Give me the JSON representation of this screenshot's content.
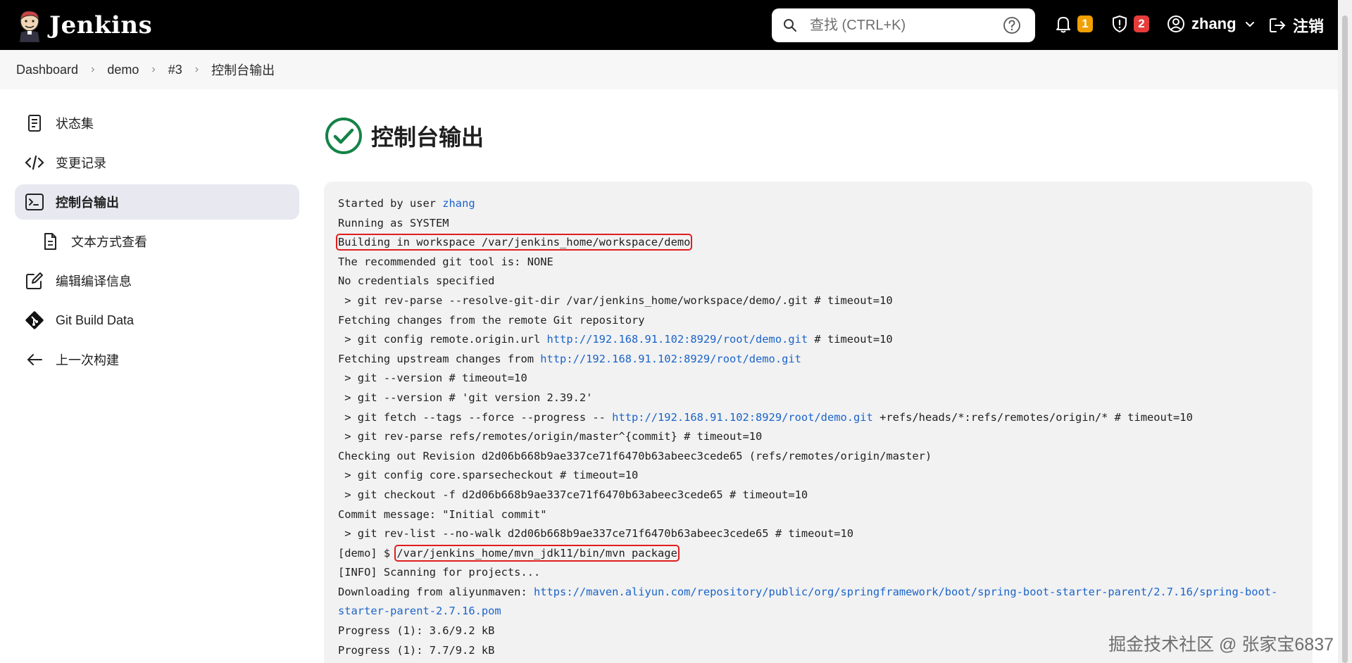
{
  "header": {
    "brand": "Jenkins",
    "search_placeholder": "查找 (CTRL+K)",
    "notifications_count": "1",
    "security_count": "2",
    "user": "zhang",
    "logout": "注销"
  },
  "breadcrumb": [
    "Dashboard",
    "demo",
    "#3",
    "控制台输出"
  ],
  "sidebar": {
    "items": [
      {
        "label": "状态集",
        "icon": "notepad-icon"
      },
      {
        "label": "变更记录",
        "icon": "code-icon"
      },
      {
        "label": "控制台输出",
        "icon": "terminal-icon"
      },
      {
        "label": "文本方式查看",
        "icon": "document-icon"
      },
      {
        "label": "编辑编译信息",
        "icon": "edit-icon"
      },
      {
        "label": "Git Build Data",
        "icon": "git-icon"
      },
      {
        "label": "上一次构建",
        "icon": "arrow-left-icon"
      }
    ]
  },
  "main": {
    "title": "控制台输出"
  },
  "console": {
    "l1_prefix": "Started by user ",
    "l1_user": "zhang",
    "l2": "Running as SYSTEM",
    "l3": "Building in workspace /var/jenkins_home/workspace/demo",
    "l4": "The recommended git tool is: NONE",
    "l5": "No credentials specified",
    "l6": " > git rev-parse --resolve-git-dir /var/jenkins_home/workspace/demo/.git # timeout=10",
    "l7": "Fetching changes from the remote Git repository",
    "l8_prefix": " > git config remote.origin.url ",
    "l8_link": "http://192.168.91.102:8929/root/demo.git",
    "l8_suffix": " # timeout=10",
    "l9_prefix": "Fetching upstream changes from ",
    "l9_link": "http://192.168.91.102:8929/root/demo.git",
    "l10": " > git --version # timeout=10",
    "l11": " > git --version # 'git version 2.39.2'",
    "l12_prefix": " > git fetch --tags --force --progress -- ",
    "l12_link": "http://192.168.91.102:8929/root/demo.git",
    "l12_suffix": " +refs/heads/*:refs/remotes/origin/* # timeout=10",
    "l13": " > git rev-parse refs/remotes/origin/master^{commit} # timeout=10",
    "l14": "Checking out Revision d2d06b668b9ae337ce71f6470b63abeec3cede65 (refs/remotes/origin/master)",
    "l15": " > git config core.sparsecheckout # timeout=10",
    "l16": " > git checkout -f d2d06b668b9ae337ce71f6470b63abeec3cede65 # timeout=10",
    "l17": "Commit message: \"Initial commit\"",
    "l18": " > git rev-list --no-walk d2d06b668b9ae337ce71f6470b63abeec3cede65 # timeout=10",
    "l19_prefix": "[demo] $ ",
    "l19_cmd": "/var/jenkins_home/mvn_jdk11/bin/mvn package",
    "l20": "[INFO] Scanning for projects...",
    "l21_prefix": "Downloading from aliyunmaven: ",
    "l21_link": "https://maven.aliyun.com/repository/public/org/springframework/boot/spring-boot-starter-parent/2.7.16/spring-boot-",
    "l22_link": "starter-parent-2.7.16.pom",
    "l23": "Progress (1): 3.6/9.2 kB",
    "l24": "Progress (1): 7.7/9.2 kB"
  },
  "footer_watermark": "掘金技术社区 @ 张家宝6837"
}
